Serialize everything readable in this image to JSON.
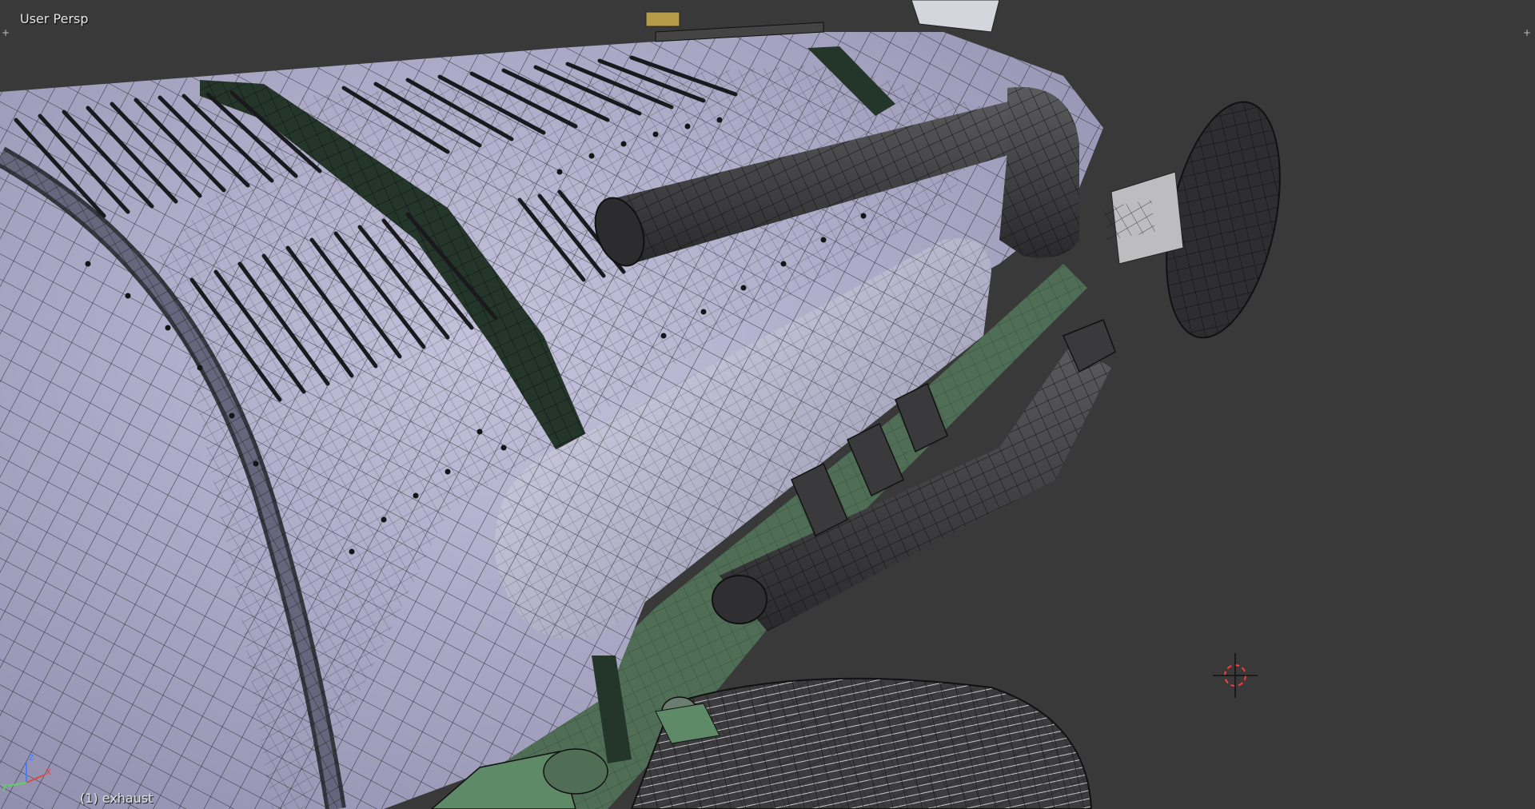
{
  "viewport": {
    "view_name": "User Persp",
    "active_object": "(1) exhaust",
    "background_color": "#393939"
  },
  "corner_widgets": {
    "top_left_icon": "split-area-plus-icon",
    "top_right_icon": "split-area-plus-icon",
    "glyph": "+"
  },
  "axis_gizmo": {
    "x_label": "x",
    "y_label": "y",
    "z_label": "z",
    "x_color": "#e04646",
    "y_color": "#5fd35f",
    "z_color": "#4b7bff"
  },
  "scene": {
    "object_name": "exhaust",
    "shading": "solid-with-wireframe",
    "body_color": "#a9a7c6",
    "pipe_color": "#3a3a3c",
    "stripe_color": "#24362a",
    "chassis_color": "#4f6e55",
    "wire_color": "#111111",
    "cursor_icon": "3d-cursor-icon"
  }
}
